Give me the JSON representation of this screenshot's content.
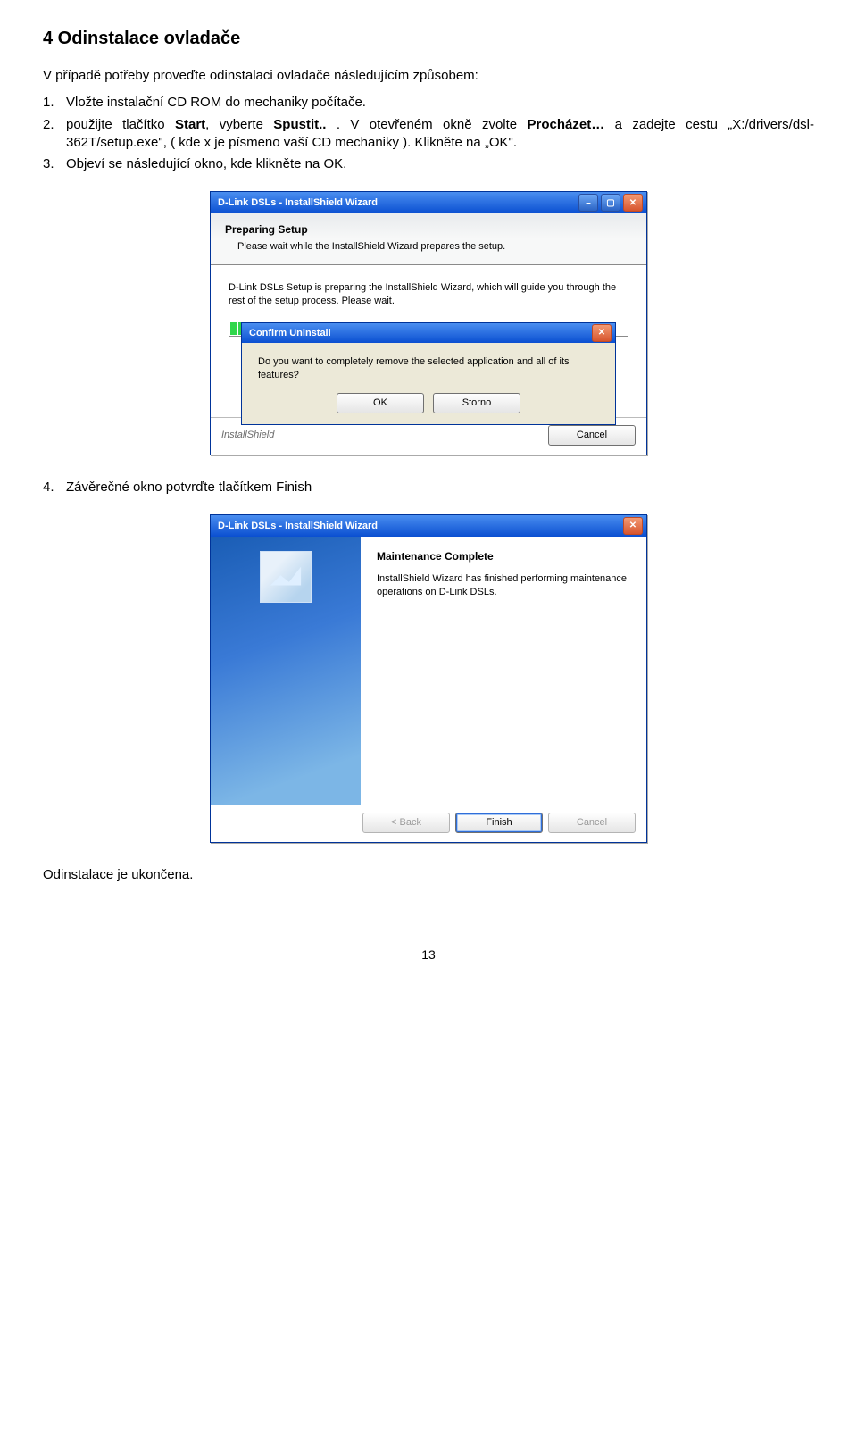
{
  "section1": {
    "heading": "4   Odinstalace ovladače",
    "intro": "V případě potřeby proveďte odinstalaci ovladače následujícím způsobem:",
    "items": [
      {
        "n": "1.",
        "text": "Vložte instalační CD ROM do mechaniky počítače."
      },
      {
        "n": "2.",
        "prefix": "použijte tlačítko ",
        "b1": "Start",
        "mid": ", vyberte ",
        "b2": "Spustit..",
        "mid2": " . V otevřeném okně zvolte ",
        "b3": "Procházet…",
        "suffix": " a zadejte cestu „X:/drivers/dsl-362T/setup.exe\", ( kde x je písmeno vaší CD mechaniky ). Klikněte na „OK\"."
      },
      {
        "n": "3.",
        "text": "Objeví se následující okno, kde klikněte na OK."
      }
    ]
  },
  "wizard1": {
    "title": "D-Link DSLs - InstallShield Wizard",
    "header_h1": "Preparing Setup",
    "header_h2": "Please wait while the InstallShield Wizard prepares the setup.",
    "body": "D-Link DSLs Setup is preparing the InstallShield Wizard, which will guide you through the rest of the setup process. Please wait.",
    "brand": "InstallShield",
    "cancel": "Cancel",
    "confirm": {
      "title": "Confirm Uninstall",
      "body": "Do you want to completely remove the selected application and all of its features?",
      "ok": "OK",
      "storno": "Storno"
    }
  },
  "step4": "Závěrečné okno potvrďte tlačítkem Finish",
  "step4_n": "4.",
  "wizard2": {
    "title": "D-Link DSLs - InstallShield Wizard",
    "h1": "Maintenance Complete",
    "body": "InstallShield Wizard has finished performing maintenance operations on D-Link DSLs.",
    "back": "< Back",
    "finish": "Finish",
    "cancel": "Cancel"
  },
  "closing": "Odinstalace je ukončena.",
  "page": "13"
}
